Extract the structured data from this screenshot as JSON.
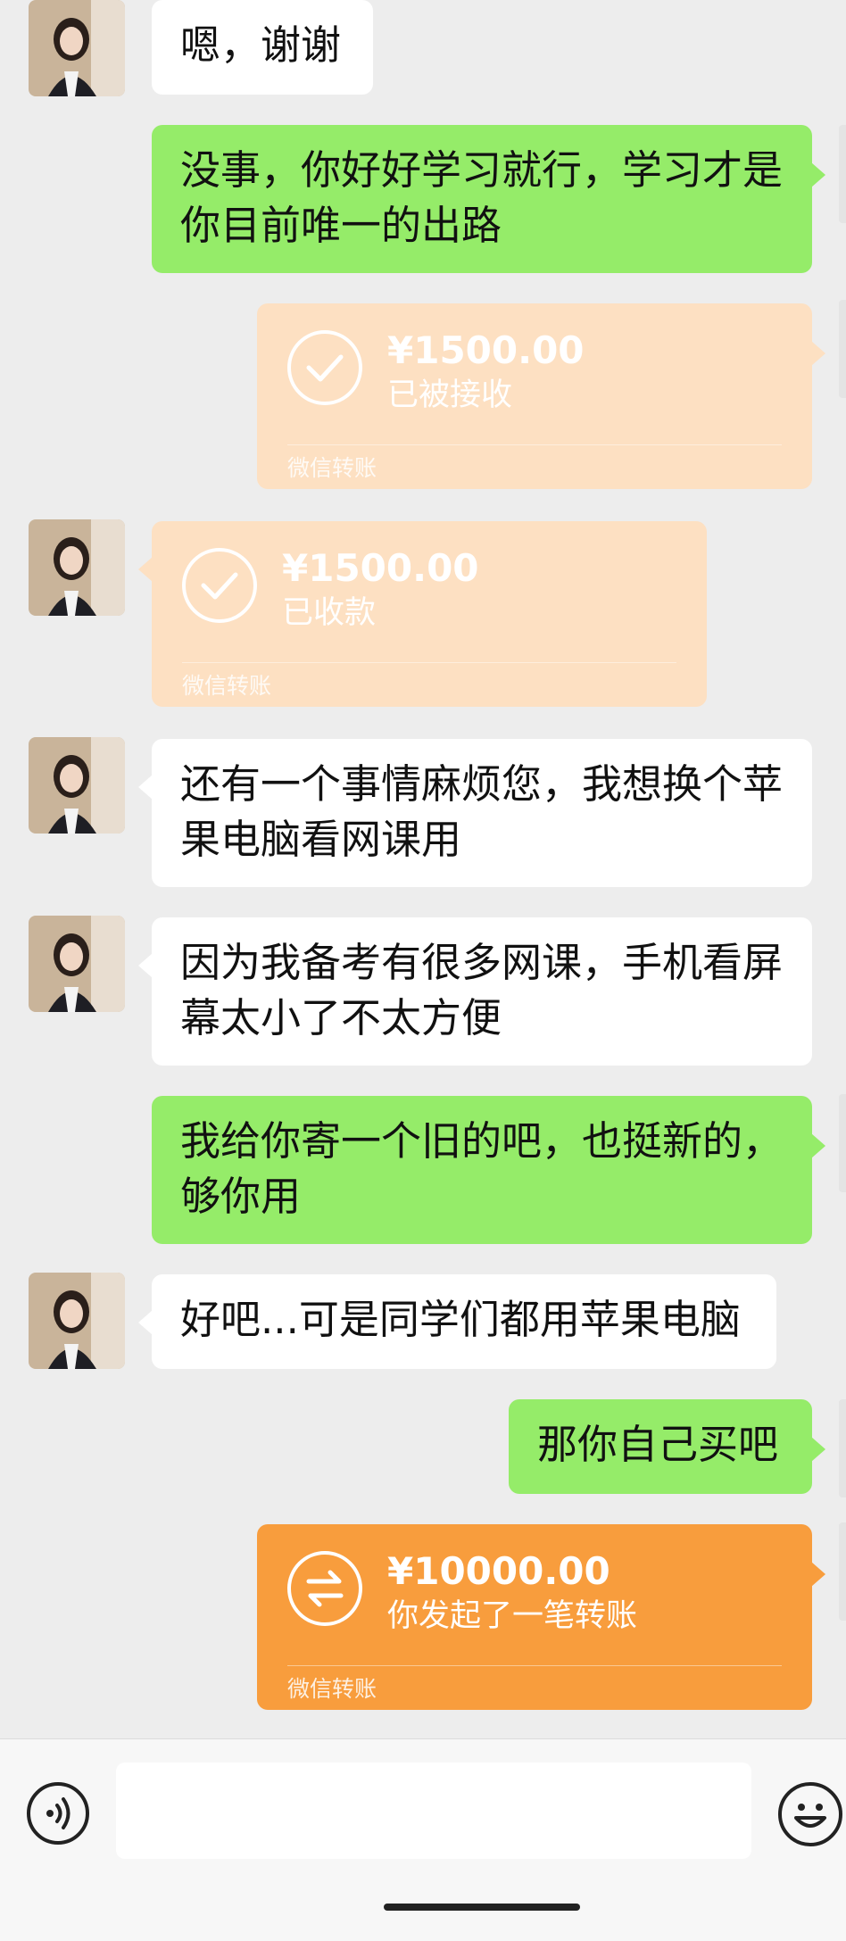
{
  "messages": [
    {
      "from": "other",
      "type": "text",
      "text": "嗯，谢谢"
    },
    {
      "from": "me",
      "type": "text",
      "text": "没事，你好好学习就行，学习才是你目前唯一的出路"
    },
    {
      "from": "me",
      "type": "transfer",
      "amount": "¥1500.00",
      "status": "已被接收",
      "label": "微信转账"
    },
    {
      "from": "other",
      "type": "transfer",
      "amount": "¥1500.00",
      "status": "已收款",
      "label": "微信转账"
    },
    {
      "from": "other",
      "type": "text",
      "text": "还有一个事情麻烦您，我想换个苹果电脑看网课用"
    },
    {
      "from": "other",
      "type": "text",
      "text": "因为我备考有很多网课，手机看屏幕太小了不太方便"
    },
    {
      "from": "me",
      "type": "text",
      "text": "我给你寄一个旧的吧，也挺新的，够你用"
    },
    {
      "from": "other",
      "type": "text",
      "text": "好吧...可是同学们都用苹果电脑"
    },
    {
      "from": "me",
      "type": "text",
      "text": "那你自己买吧"
    },
    {
      "from": "me",
      "type": "transfer",
      "amount": "¥10000.00",
      "status": "你发起了一笔转账",
      "label": "微信转账"
    }
  ],
  "input_bar": {
    "voice_icon": "voice-icon",
    "text_value": "",
    "emoji_icon": "emoji-icon"
  },
  "colors": {
    "background": "#ededed",
    "bubble_me": "#95ec69",
    "bubble_other": "#ffffff",
    "transfer_received": "#fde0c2",
    "transfer_pending": "#f89d3d"
  }
}
